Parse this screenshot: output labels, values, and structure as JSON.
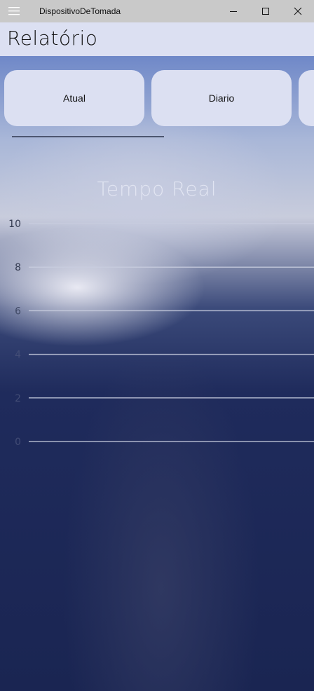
{
  "window": {
    "title": "DispositivoDeTomada",
    "menu_icon": "hamburger-icon",
    "controls": [
      "minimize-icon",
      "maximize-icon",
      "close-icon"
    ]
  },
  "header": {
    "title": "Relatório"
  },
  "tabs": [
    {
      "label": "Atual"
    },
    {
      "label": "Diario"
    },
    {
      "label": ""
    }
  ],
  "chart_data": {
    "type": "line",
    "title": "Tempo Real",
    "xlabel": "",
    "ylabel": "",
    "ylim": [
      0,
      10
    ],
    "yticks": [
      10,
      8,
      6,
      4,
      2,
      0
    ],
    "grid": true,
    "series": []
  }
}
